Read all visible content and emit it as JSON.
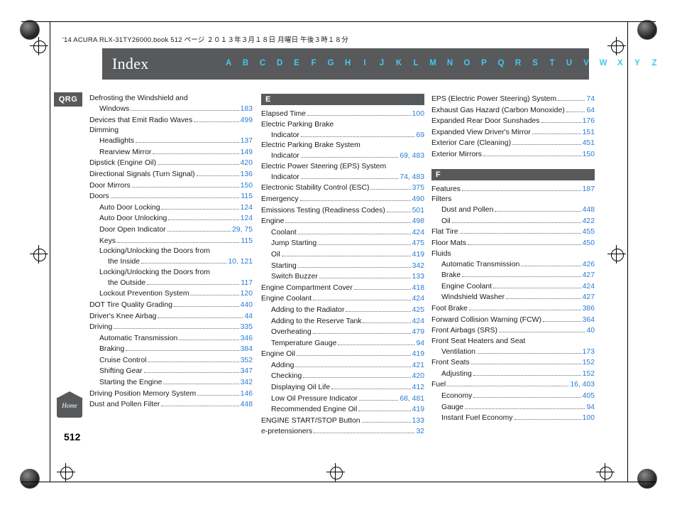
{
  "page": {
    "meta_line": "'14 ACURA RLX-31TY26000.book   512 ページ   ２０１３年３月１８日   月曜日   午後３時１８分",
    "number": "512",
    "qrg_tab": "QRG",
    "home_label": "Home"
  },
  "banner": {
    "title": "Index",
    "letters": [
      "A",
      "B",
      "C",
      "D",
      "E",
      "F",
      "G",
      "H",
      "I",
      "J",
      "K",
      "L",
      "M",
      "N",
      "O",
      "P",
      "Q",
      "R",
      "S",
      "T",
      "U",
      "V",
      "W",
      "X",
      "Y",
      "Z"
    ]
  },
  "columns": [
    {
      "id": "col1",
      "sections": [
        {
          "letter": "",
          "entries": [
            {
              "text": "Defrosting the Windshield and",
              "page": "",
              "indent": 0,
              "dots": false
            },
            {
              "text": "Windows",
              "page": "183",
              "indent": 1,
              "dots": true
            },
            {
              "text": "Devices that Emit Radio Waves",
              "page": "499",
              "indent": 0,
              "dots": true
            },
            {
              "text": "Dimming",
              "page": "",
              "indent": 0,
              "dots": false
            },
            {
              "text": "Headlights",
              "page": "137",
              "indent": 1,
              "dots": true
            },
            {
              "text": "Rearview Mirror",
              "page": "149",
              "indent": 1,
              "dots": true
            },
            {
              "text": "Dipstick (Engine Oil)",
              "page": "420",
              "indent": 0,
              "dots": true
            },
            {
              "text": "Directional Signals (Turn Signal)",
              "page": "136",
              "indent": 0,
              "dots": true
            },
            {
              "text": "Door Mirrors",
              "page": "150",
              "indent": 0,
              "dots": true
            },
            {
              "text": "Doors",
              "page": "115",
              "indent": 0,
              "dots": true
            },
            {
              "text": "Auto Door Locking",
              "page": "124",
              "indent": 1,
              "dots": true
            },
            {
              "text": "Auto Door Unlocking",
              "page": "124",
              "indent": 1,
              "dots": true
            },
            {
              "text": "Door Open Indicator",
              "page": "29, 75",
              "indent": 1,
              "dots": true
            },
            {
              "text": "Keys",
              "page": "115",
              "indent": 1,
              "dots": true
            },
            {
              "text": "Locking/Unlocking the Doors from",
              "page": "",
              "indent": 1,
              "dots": false
            },
            {
              "text": "the Inside",
              "page": "10, 121",
              "indent": 2,
              "dots": true
            },
            {
              "text": "Locking/Unlocking the Doors from",
              "page": "",
              "indent": 1,
              "dots": false
            },
            {
              "text": "the Outside",
              "page": "117",
              "indent": 2,
              "dots": true
            },
            {
              "text": "Lockout Prevention System",
              "page": "120",
              "indent": 1,
              "dots": true
            },
            {
              "text": "DOT Tire Quality Grading",
              "page": "440",
              "indent": 0,
              "dots": true
            },
            {
              "text": "Driver's Knee Airbag",
              "page": "44",
              "indent": 0,
              "dots": true
            },
            {
              "text": "Driving",
              "page": "335",
              "indent": 0,
              "dots": true
            },
            {
              "text": "Automatic Transmission",
              "page": "346",
              "indent": 1,
              "dots": true
            },
            {
              "text": "Braking",
              "page": "384",
              "indent": 1,
              "dots": true
            },
            {
              "text": "Cruise Control",
              "page": "352",
              "indent": 1,
              "dots": true
            },
            {
              "text": "Shifting Gear",
              "page": "347",
              "indent": 1,
              "dots": true
            },
            {
              "text": "Starting the Engine",
              "page": "342",
              "indent": 1,
              "dots": true
            },
            {
              "text": "Driving Position Memory System",
              "page": "146",
              "indent": 0,
              "dots": true
            },
            {
              "text": "Dust and Pollen Filter",
              "page": "448",
              "indent": 0,
              "dots": true
            }
          ]
        }
      ]
    },
    {
      "id": "col2",
      "sections": [
        {
          "letter": "E",
          "entries": [
            {
              "text": "Elapsed Time",
              "page": "100",
              "indent": 0,
              "dots": true
            },
            {
              "text": "Electric Parking Brake",
              "page": "",
              "indent": 0,
              "dots": false
            },
            {
              "text": "Indicator",
              "page": "69",
              "indent": 1,
              "dots": true
            },
            {
              "text": "Electric Parking Brake System",
              "page": "",
              "indent": 0,
              "dots": false
            },
            {
              "text": "Indicator",
              "page": "69, 483",
              "indent": 1,
              "dots": true
            },
            {
              "text": "Electric Power Steering (EPS) System",
              "page": "",
              "indent": 0,
              "dots": false
            },
            {
              "text": "Indicator",
              "page": "74, 483",
              "indent": 1,
              "dots": true
            },
            {
              "text": "Electronic Stability Control (ESC)",
              "page": "375",
              "indent": 0,
              "dots": true
            },
            {
              "text": "Emergency",
              "page": "490",
              "indent": 0,
              "dots": true
            },
            {
              "text": "Emissions Testing (Readiness Codes)",
              "page": "501",
              "indent": 0,
              "dots": true
            },
            {
              "text": "Engine",
              "page": "498",
              "indent": 0,
              "dots": true
            },
            {
              "text": "Coolant",
              "page": "424",
              "indent": 1,
              "dots": true
            },
            {
              "text": "Jump Starting",
              "page": "475",
              "indent": 1,
              "dots": true
            },
            {
              "text": "Oil",
              "page": "419",
              "indent": 1,
              "dots": true
            },
            {
              "text": "Starting",
              "page": "342",
              "indent": 1,
              "dots": true
            },
            {
              "text": "Switch Buzzer",
              "page": "133",
              "indent": 1,
              "dots": true
            },
            {
              "text": "Engine Compartment Cover",
              "page": "418",
              "indent": 0,
              "dots": true
            },
            {
              "text": "Engine Coolant",
              "page": "424",
              "indent": 0,
              "dots": true
            },
            {
              "text": "Adding to the Radiator",
              "page": "425",
              "indent": 1,
              "dots": true
            },
            {
              "text": "Adding to the Reserve Tank",
              "page": "424",
              "indent": 1,
              "dots": true
            },
            {
              "text": "Overheating",
              "page": "479",
              "indent": 1,
              "dots": true
            },
            {
              "text": "Temperature Gauge",
              "page": "94",
              "indent": 1,
              "dots": true
            },
            {
              "text": "Engine Oil",
              "page": "419",
              "indent": 0,
              "dots": true
            },
            {
              "text": "Adding",
              "page": "421",
              "indent": 1,
              "dots": true
            },
            {
              "text": "Checking",
              "page": "420",
              "indent": 1,
              "dots": true
            },
            {
              "text": "Displaying Oil Life",
              "page": "412",
              "indent": 1,
              "dots": true
            },
            {
              "text": "Low Oil Pressure Indicator",
              "page": "68, 481",
              "indent": 1,
              "dots": true
            },
            {
              "text": "Recommended Engine Oil",
              "page": "419",
              "indent": 1,
              "dots": true
            },
            {
              "text": "ENGINE START/STOP Button",
              "page": "133",
              "indent": 0,
              "dots": true
            },
            {
              "text": "e-pretensioners",
              "page": "32",
              "indent": 0,
              "dots": true
            }
          ]
        }
      ]
    },
    {
      "id": "col3",
      "sections": [
        {
          "letter": "",
          "entries": [
            {
              "text": "EPS (Electric Power Steering) System",
              "page": "74",
              "indent": 0,
              "dots": true
            },
            {
              "text": "Exhaust Gas Hazard (Carbon Monoxide)",
              "page": "64",
              "indent": 0,
              "dots": true
            },
            {
              "text": "Expanded Rear Door Sunshades",
              "page": "176",
              "indent": 0,
              "dots": true
            },
            {
              "text": "Expanded View Driver's Mirror",
              "page": "151",
              "indent": 0,
              "dots": true
            },
            {
              "text": "Exterior Care (Cleaning)",
              "page": "451",
              "indent": 0,
              "dots": true
            },
            {
              "text": "Exterior Mirrors",
              "page": "150",
              "indent": 0,
              "dots": true
            }
          ]
        },
        {
          "letter": "F",
          "entries": [
            {
              "text": "Features",
              "page": "187",
              "indent": 0,
              "dots": true
            },
            {
              "text": "Filters",
              "page": "",
              "indent": 0,
              "dots": false
            },
            {
              "text": "Dust and Pollen",
              "page": "448",
              "indent": 1,
              "dots": true
            },
            {
              "text": "Oil",
              "page": "422",
              "indent": 1,
              "dots": true
            },
            {
              "text": "Flat Tire",
              "page": "455",
              "indent": 0,
              "dots": true
            },
            {
              "text": "Floor Mats",
              "page": "450",
              "indent": 0,
              "dots": true
            },
            {
              "text": "Fluids",
              "page": "",
              "indent": 0,
              "dots": false
            },
            {
              "text": "Automatic Transmission",
              "page": "426",
              "indent": 1,
              "dots": true
            },
            {
              "text": "Brake",
              "page": "427",
              "indent": 1,
              "dots": true
            },
            {
              "text": "Engine Coolant",
              "page": "424",
              "indent": 1,
              "dots": true
            },
            {
              "text": "Windshield Washer",
              "page": "427",
              "indent": 1,
              "dots": true
            },
            {
              "text": "Foot Brake",
              "page": "386",
              "indent": 0,
              "dots": true
            },
            {
              "text": "Forward Collision Warning (FCW)",
              "page": "364",
              "indent": 0,
              "dots": true
            },
            {
              "text": "Front Airbags (SRS)",
              "page": "40",
              "indent": 0,
              "dots": true
            },
            {
              "text": "Front Seat Heaters and Seat",
              "page": "",
              "indent": 0,
              "dots": false
            },
            {
              "text": "Ventilation",
              "page": "173",
              "indent": 1,
              "dots": true
            },
            {
              "text": "Front Seats",
              "page": "152",
              "indent": 0,
              "dots": true
            },
            {
              "text": "Adjusting",
              "page": "152",
              "indent": 1,
              "dots": true
            },
            {
              "text": "Fuel",
              "page": "16, 403",
              "indent": 0,
              "dots": true
            },
            {
              "text": "Economy",
              "page": "405",
              "indent": 1,
              "dots": true
            },
            {
              "text": "Gauge",
              "page": "94",
              "indent": 1,
              "dots": true
            },
            {
              "text": "Instant Fuel Economy",
              "page": "100",
              "indent": 1,
              "dots": true
            }
          ]
        }
      ]
    }
  ],
  "colors": {
    "banner": "#58595b",
    "letter_nav": "#45c6f0",
    "page_number_link": "#2b7bd4"
  }
}
